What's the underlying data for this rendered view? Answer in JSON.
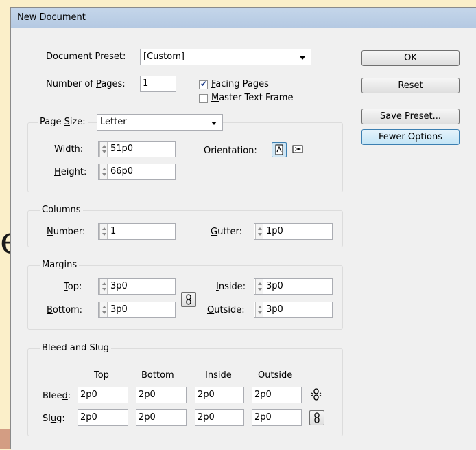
{
  "background": {
    "partial_letter": "e"
  },
  "dialog": {
    "title": "New Document",
    "document_preset": {
      "label": "Document Preset:",
      "value": "[Custom]"
    },
    "number_of_pages": {
      "label": "Number of Pages:",
      "value": "1"
    },
    "facing_pages": {
      "label": "Facing Pages",
      "checked": true
    },
    "master_text_frame": {
      "label": "Master Text Frame",
      "checked": false
    },
    "page_size": {
      "label": "Page Size:",
      "value": "Letter",
      "width_label": "Width:",
      "width": "51p0",
      "height_label": "Height:",
      "height": "66p0",
      "orientation_label": "Orientation:"
    },
    "columns": {
      "title": "Columns",
      "number_label": "Number:",
      "number": "1",
      "gutter_label": "Gutter:",
      "gutter": "1p0"
    },
    "margins": {
      "title": "Margins",
      "top_label": "Top:",
      "top": "3p0",
      "bottom_label": "Bottom:",
      "bottom": "3p0",
      "inside_label": "Inside:",
      "inside": "3p0",
      "outside_label": "Outside:",
      "outside": "3p0"
    },
    "bleed_slug": {
      "title": "Bleed and Slug",
      "headers": [
        "Top",
        "Bottom",
        "Inside",
        "Outside"
      ],
      "bleed_label": "Bleed:",
      "bleed": [
        "2p0",
        "2p0",
        "2p0",
        "2p0"
      ],
      "slug_label": "Slug:",
      "slug": [
        "2p0",
        "2p0",
        "2p0",
        "2p0"
      ]
    },
    "buttons": {
      "ok": "OK",
      "reset": "Reset",
      "save_preset": "Save Preset...",
      "fewer_options": "Fewer Options"
    }
  },
  "colors": {
    "background": "#fbefc9",
    "dialog": "#f0f0f0",
    "titlebar": "#b9cde4",
    "accent_bar": "#d39d83"
  }
}
